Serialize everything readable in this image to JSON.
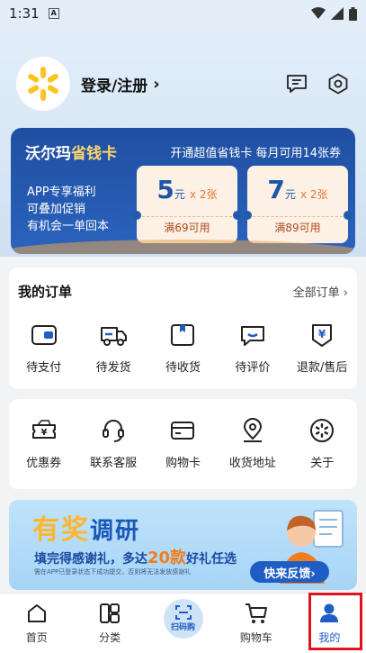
{
  "status_bar": {
    "time": "1:31",
    "notif": "A"
  },
  "profile": {
    "login_label": "登录/注册",
    "chevron": "›"
  },
  "savings_card": {
    "title_part1": "沃尔玛",
    "title_part2": "省钱卡",
    "subtitle": "开通超值省钱卡 每月可用14张券",
    "perks": [
      "APP专享福利",
      "可叠加促销",
      "有机会一单回本"
    ],
    "coupons": [
      {
        "amount": "5",
        "unit": "元",
        "multiplier": "x 2张",
        "condition": "满69可用"
      },
      {
        "amount": "7",
        "unit": "元",
        "multiplier": "x 2张",
        "condition": "满89可用"
      }
    ],
    "colors": {
      "bg": "#2557ad",
      "gold": "#ffd66b",
      "coupon_bg": "#fdf0e4"
    }
  },
  "orders": {
    "title": "我的订单",
    "all_label": "全部订单 ›",
    "items": [
      {
        "label": "待支付",
        "icon": "wallet-icon"
      },
      {
        "label": "待发货",
        "icon": "truck-icon"
      },
      {
        "label": "待收货",
        "icon": "package-icon"
      },
      {
        "label": "待评价",
        "icon": "review-icon"
      },
      {
        "label": "退款/售后",
        "icon": "refund-icon"
      }
    ]
  },
  "services": {
    "items": [
      {
        "label": "优惠券",
        "icon": "coupon-icon"
      },
      {
        "label": "联系客服",
        "icon": "headset-icon"
      },
      {
        "label": "购物卡",
        "icon": "card-icon"
      },
      {
        "label": "收货地址",
        "icon": "location-icon"
      },
      {
        "label": "关于",
        "icon": "about-icon"
      }
    ]
  },
  "banner": {
    "headline_part1": "有奖",
    "headline_part2": "调研",
    "line2_part1": "填完得感谢礼，多达",
    "line2_highlight": "20款",
    "line2_part3": "好礼任选",
    "fine_print": "需在APP已登录状态下成功提交，否则将无法发放感谢礼",
    "cta": "快来反馈›"
  },
  "tabbar": {
    "tabs": [
      {
        "label": "首页",
        "icon": "home-icon"
      },
      {
        "label": "分类",
        "icon": "category-icon"
      },
      {
        "label": "扫码购",
        "icon": "scan-icon"
      },
      {
        "label": "购物车",
        "icon": "cart-icon"
      },
      {
        "label": "我的",
        "icon": "profile-icon"
      }
    ]
  }
}
